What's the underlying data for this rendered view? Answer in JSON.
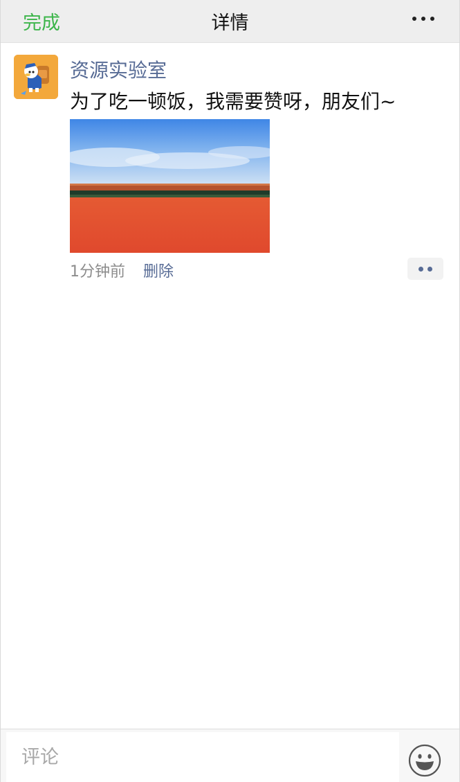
{
  "navbar": {
    "done_label": "完成",
    "title": "详情",
    "more_icon": "more-dots-icon"
  },
  "post": {
    "author": "资源实验室",
    "text": "为了吃一顿饭，我需要赞呀，朋友们~",
    "time": "1分钟前",
    "delete_label": "删除",
    "action_icon": "comment-action-icon"
  },
  "comment_bar": {
    "placeholder": "评论",
    "emoji_icon": "emoji-icon"
  },
  "colors": {
    "accent_green": "#3cb54a",
    "link_blue": "#576b95",
    "nav_bg": "#eeeeee",
    "wall_red": "#e0492d",
    "sky_blue": "#4a8fe0",
    "avatar_bg": "#f3a83b"
  }
}
